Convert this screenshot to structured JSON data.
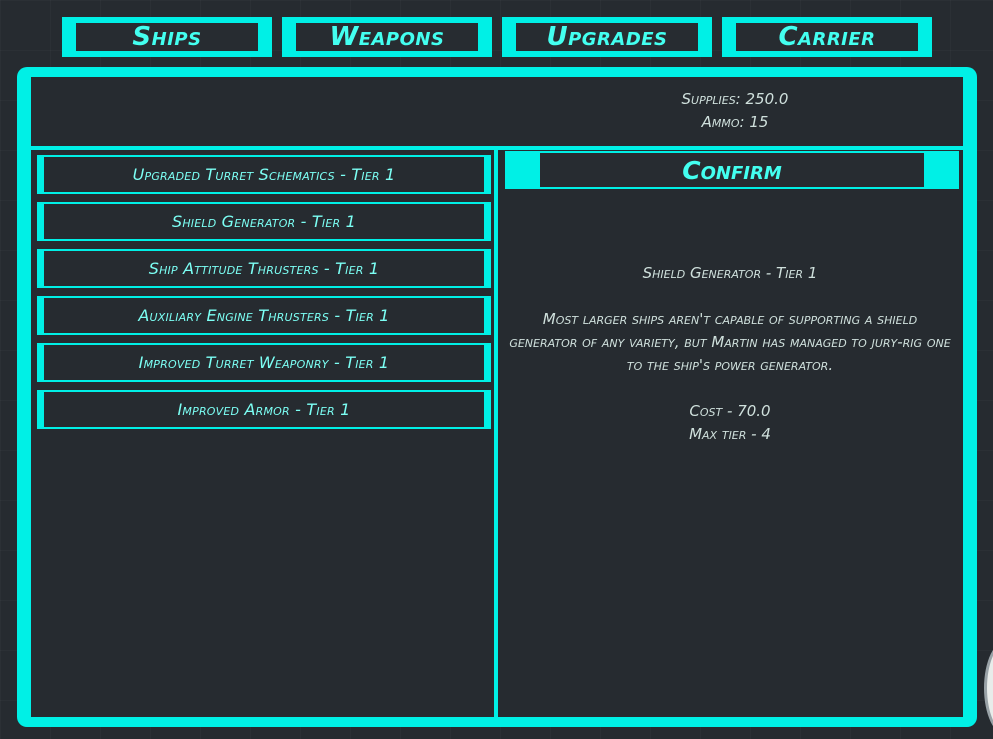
{
  "tabs": [
    {
      "label": "Ships"
    },
    {
      "label": "Weapons"
    },
    {
      "label": "Upgrades"
    },
    {
      "label": "Carrier"
    }
  ],
  "resources": {
    "supplies": "Supplies: 250.0",
    "ammo": "Ammo: 15"
  },
  "upgrades": [
    {
      "label": "Upgraded Turret Schematics - Tier 1"
    },
    {
      "label": "Shield Generator - Tier 1"
    },
    {
      "label": "Ship Attitude Thrusters - Tier 1"
    },
    {
      "label": "Auxiliary Engine Thrusters - Tier 1"
    },
    {
      "label": "Improved Turret Weaponry - Tier 1"
    },
    {
      "label": "Improved Armor - Tier 1"
    }
  ],
  "confirm_label": "Confirm",
  "detail": {
    "title": "Shield Generator - Tier 1",
    "description": "Most larger ships aren't capable of supporting a shield generator of any variety, but Martin has managed to jury-rig one to the ship's power generator.",
    "cost": "Cost - 70.0",
    "max_tier": "Max tier - 4"
  },
  "colors": {
    "accent": "#00f0e6",
    "background": "#262b30",
    "text": "#cfe0dc"
  }
}
